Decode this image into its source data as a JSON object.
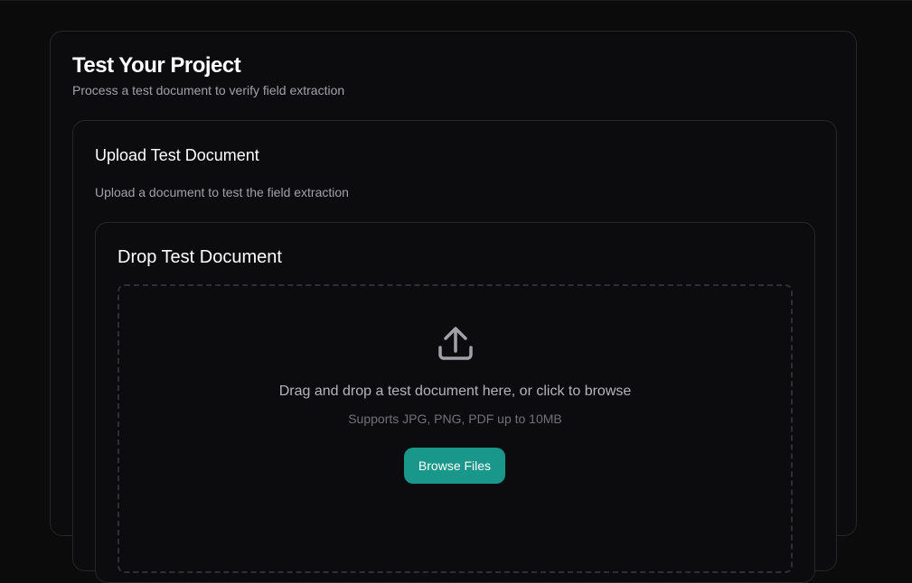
{
  "header": {
    "title": "Test Your Project",
    "subtitle": "Process a test document to verify field extraction"
  },
  "upload_section": {
    "title": "Upload Test Document",
    "description": "Upload a document to test the field extraction"
  },
  "dropzone": {
    "title": "Drop Test Document",
    "icon": "upload-icon",
    "instructions": "Drag and drop a test document here, or click to browse",
    "hint": "Supports JPG, PNG, PDF up to 10MB",
    "button_label": "Browse Files"
  },
  "colors": {
    "background": "#0b0b0c",
    "card_border": "#27272a",
    "accent": "#18978a",
    "muted_text": "#a1a1aa"
  }
}
